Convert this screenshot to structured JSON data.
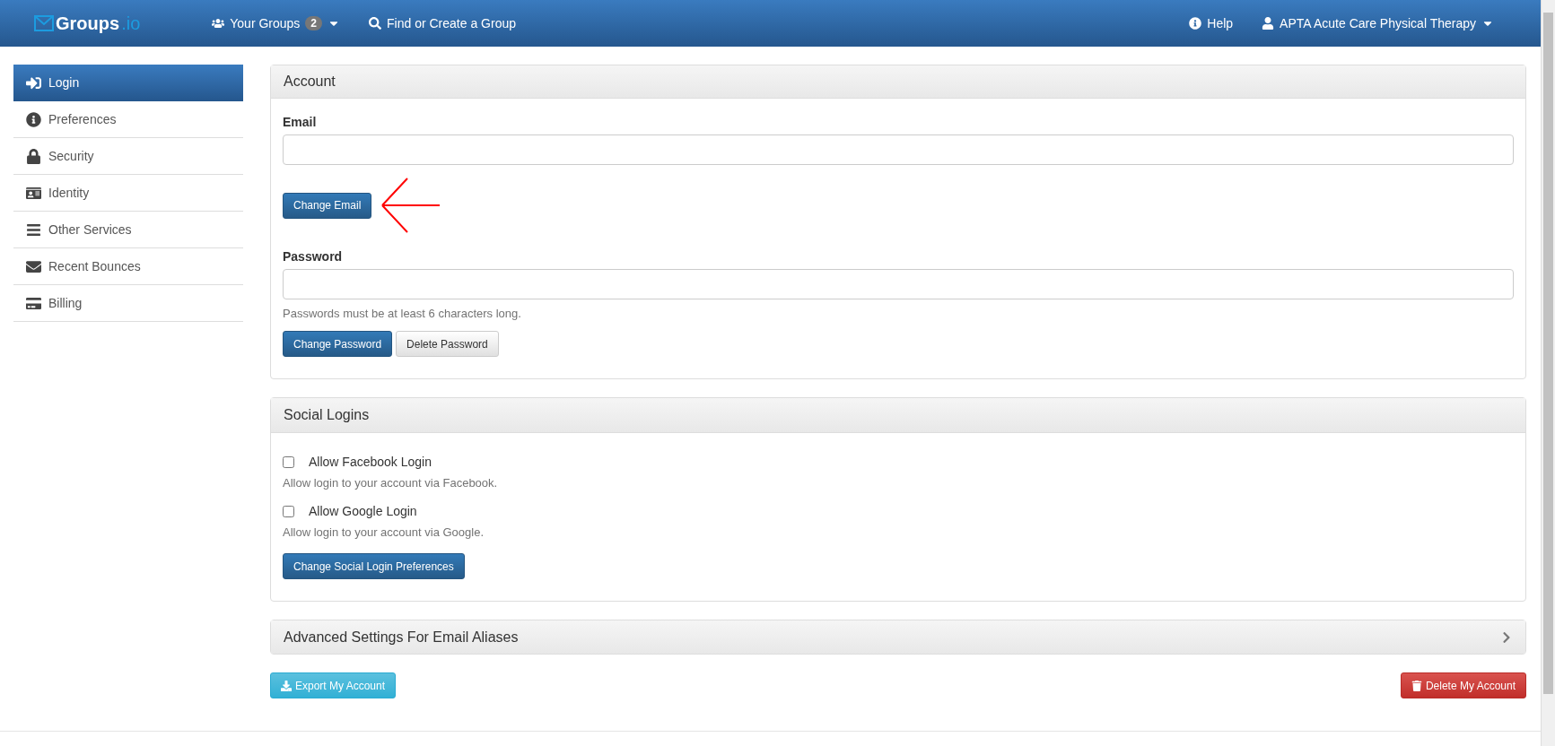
{
  "navbar": {
    "brand_name": "Groups",
    "brand_suffix": ".io",
    "items": [
      {
        "label": "Your Groups",
        "badge": "2",
        "dropdown": true
      },
      {
        "label": "Find or Create a Group",
        "dropdown": false
      }
    ],
    "right_items": [
      {
        "label": "Help",
        "dropdown": false
      },
      {
        "label": "APTA Acute Care Physical Therapy",
        "dropdown": true
      }
    ]
  },
  "sidebar": {
    "items": [
      {
        "label": "Login",
        "selected": true
      },
      {
        "label": "Preferences",
        "selected": false
      },
      {
        "label": "Security",
        "selected": false
      },
      {
        "label": "Identity",
        "selected": false
      },
      {
        "label": "Other Services",
        "selected": false
      },
      {
        "label": "Recent Bounces",
        "selected": false
      },
      {
        "label": "Billing",
        "selected": false
      }
    ]
  },
  "account": {
    "title": "Account",
    "email": {
      "label": "Email",
      "button": "Change Email"
    },
    "password": {
      "label": "Password",
      "help": "Passwords must be at least 6 characters long.",
      "buttons": [
        {
          "label": "Change Password",
          "kind": "primary"
        },
        {
          "label": "Delete Password",
          "kind": "default"
        }
      ]
    }
  },
  "social_logins": {
    "title": "Social Logins",
    "options": [
      {
        "label": "Allow Facebook Login",
        "checked": false,
        "help": "Allow login to your account via Facebook."
      },
      {
        "label": "Allow Google Login",
        "checked": false,
        "help": "Allow login to your account via Google."
      }
    ],
    "button": "Change Social Login Preferences"
  },
  "advanced": {
    "title": "Advanced Settings For Email Aliases",
    "expanded": false
  },
  "actions": [
    {
      "label": "Export My Account",
      "kind": "info"
    },
    {
      "label": "Delete My Account",
      "kind": "danger"
    }
  ]
}
